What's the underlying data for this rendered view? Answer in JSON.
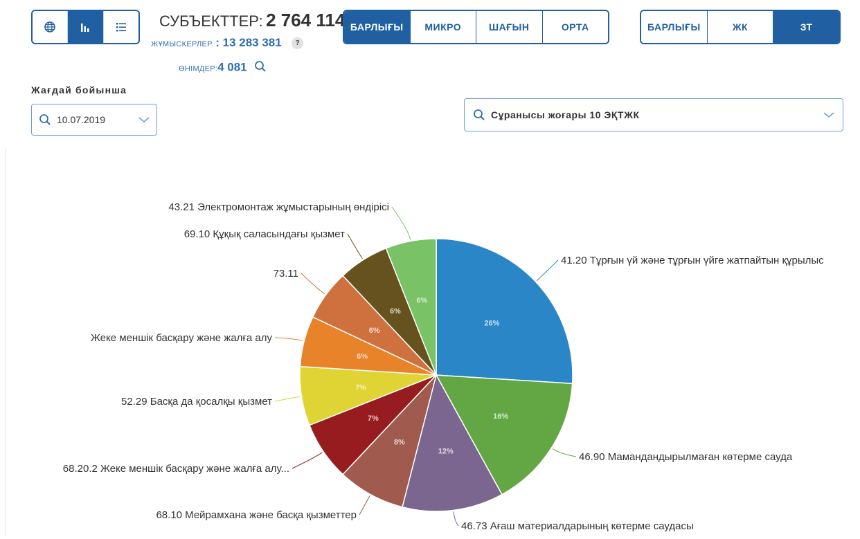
{
  "view_toggle": {
    "items": [
      {
        "name": "globe-icon"
      },
      {
        "name": "bar-chart-icon"
      },
      {
        "name": "list-icon"
      }
    ],
    "active_index": 1
  },
  "stats": {
    "subjects_label": "СУБЪЕКТТЕР:",
    "subjects_value": "2 764 114",
    "workers_label": "ЖҰМЫСКЕРЛЕР",
    "workers_value": ": 13 283 381",
    "help_label": "?",
    "products_label": "ӨНІМДЕР:",
    "products_value": "4 081"
  },
  "size_filter": {
    "options": [
      "БАРЛЫҒЫ",
      "МИКРО",
      "ШАҒЫН",
      "ОРТА"
    ],
    "active_index": 0
  },
  "type_filter": {
    "options": [
      "БАРЛЫҒЫ",
      "ЖК",
      "ЗТ"
    ],
    "active_index": 2
  },
  "situation": {
    "label": "Жағдай бойынша",
    "date": "10.07.2019"
  },
  "top_select": {
    "value": "Сұранысы жоғары 10 ЭҚТЖК"
  },
  "colors": {
    "accent": "#1f5fa2"
  },
  "chart_data": {
    "type": "pie",
    "slices": [
      {
        "label": "41.20 Тұрғын үй және тұрғын үйге жатпайтын құрылыс",
        "value": 26,
        "pct_label": "26%",
        "color": "#2a86c7"
      },
      {
        "label": "46.90 Мамандандырылмаған көтерме сауда",
        "value": 16,
        "pct_label": "16%",
        "color": "#63a744"
      },
      {
        "label": "46.73 Ағаш материалдарының көтерме саудасы",
        "value": 12,
        "pct_label": "12%",
        "color": "#7b6690"
      },
      {
        "label": "68.10 Мейрамхана және басқа қызметтер",
        "value": 8,
        "pct_label": "8%",
        "color": "#a05a4e"
      },
      {
        "label": "68.20.2 Жеке меншік басқару және жалға алу...",
        "value": 7,
        "pct_label": "7%",
        "color": "#961c1f"
      },
      {
        "label": "52.29 Басқа да қосалқы қызмет",
        "value": 7,
        "pct_label": "7%",
        "color": "#dfd433"
      },
      {
        "label": "Жеке меншік басқару және жалға алу",
        "value": 6,
        "pct_label": "6%",
        "color": "#e8832a"
      },
      {
        "label": "73.11",
        "value": 6,
        "pct_label": "6%",
        "color": "#cf713e"
      },
      {
        "label": "69.10 Құқық саласындағы қызмет",
        "value": 6,
        "pct_label": "6%",
        "color": "#66521e"
      },
      {
        "label": "43.21 Электромонтаж жұмыстарының өндірісі",
        "value": 6,
        "pct_label": "6%",
        "color": "#79c266"
      }
    ]
  }
}
